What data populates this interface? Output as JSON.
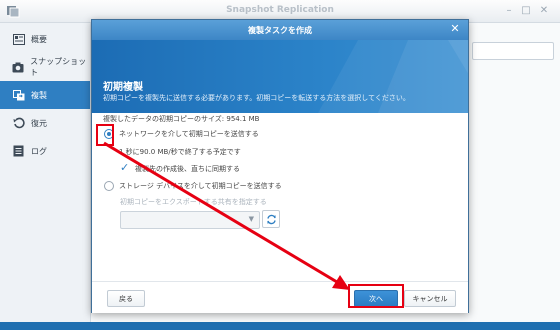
{
  "app": {
    "title": "Snapshot Replication",
    "icon": "snapshot-replication-app-icon",
    "window_controls": [
      "minimize-icon",
      "maximize-icon",
      "close-icon"
    ]
  },
  "sidebar": {
    "items": [
      {
        "label": "概要",
        "icon": "overview-icon",
        "active": false
      },
      {
        "label": "スナップショット",
        "icon": "camera-icon",
        "active": false
      },
      {
        "label": "複製",
        "icon": "replication-icon",
        "active": true
      },
      {
        "label": "復元",
        "icon": "restore-icon",
        "active": false
      },
      {
        "label": "ログ",
        "icon": "log-icon",
        "active": false
      }
    ]
  },
  "dialog": {
    "title": "複製タスクを作成",
    "banner": {
      "title": "初期複製",
      "subtitle": "初期コピーを複製先に送信する必要があります。初期コピーを転送する方法を選択してください。"
    },
    "size_label": "複製したデータの初期コピーのサイズ: 954.1 MB",
    "options": {
      "network": {
        "label": "ネットワークを介して初期コピーを送信する",
        "selected": true,
        "estimate": "1 秒に90.0 MB/秒で終了する予定です",
        "sync_label": "複製先の作成後、直ちに同期する",
        "sync_checked": true
      },
      "storage": {
        "label": "ストレージ デバイスを介して初期コピーを送信する",
        "selected": false,
        "export_label": "初期コピーをエクスポートする共有を指定する",
        "select_value": ""
      }
    },
    "buttons": {
      "back": "戻る",
      "next": "次へ",
      "cancel": "キャンセル"
    }
  },
  "colors": {
    "accent": "#2f7fc2",
    "highlight": "#e60012"
  }
}
